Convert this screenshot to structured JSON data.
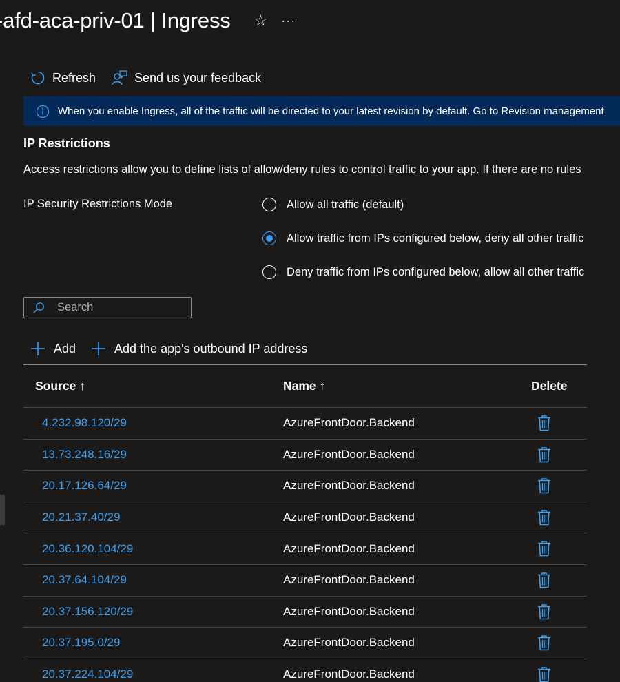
{
  "header": {
    "title": "-afd-aca-priv-01 | Ingress",
    "favorite_icon": "star-icon",
    "more_icon": "ellipsis-icon"
  },
  "toolbar": {
    "refresh_label": "Refresh",
    "feedback_label": "Send us your feedback"
  },
  "banner": {
    "text": "When you enable Ingress, all of the traffic will be directed to your latest revision by default. Go to Revision management"
  },
  "ip_restrictions": {
    "title": "IP Restrictions",
    "description": "Access restrictions allow you to define lists of allow/deny rules to control traffic to your app. If there are no rules",
    "mode_label": "IP Security Restrictions Mode",
    "options": [
      {
        "label": "Allow all traffic (default)",
        "checked": false
      },
      {
        "label": "Allow traffic from IPs configured below, deny all other traffic",
        "checked": true
      },
      {
        "label": "Deny traffic from IPs configured below, allow all other traffic",
        "checked": false
      }
    ]
  },
  "search": {
    "placeholder": "Search"
  },
  "actions": {
    "add_label": "Add",
    "add_outbound_label": "Add the app's outbound IP address"
  },
  "table": {
    "columns": {
      "source": "Source ↑",
      "name": "Name ↑",
      "delete": "Delete"
    },
    "rows": [
      {
        "source": "4.232.98.120/29",
        "name": "AzureFrontDoor.Backend"
      },
      {
        "source": "13.73.248.16/29",
        "name": "AzureFrontDoor.Backend"
      },
      {
        "source": "20.17.126.64/29",
        "name": "AzureFrontDoor.Backend"
      },
      {
        "source": "20.21.37.40/29",
        "name": "AzureFrontDoor.Backend"
      },
      {
        "source": "20.36.120.104/29",
        "name": "AzureFrontDoor.Backend"
      },
      {
        "source": "20.37.64.104/29",
        "name": "AzureFrontDoor.Backend"
      },
      {
        "source": "20.37.156.120/29",
        "name": "AzureFrontDoor.Backend"
      },
      {
        "source": "20.37.195.0/29",
        "name": "AzureFrontDoor.Backend"
      },
      {
        "source": "20.37.224.104/29",
        "name": "AzureFrontDoor.Backend"
      }
    ]
  },
  "colors": {
    "background": "#1b1a19",
    "accent": "#3aa0f3",
    "banner": "#042a5a"
  }
}
